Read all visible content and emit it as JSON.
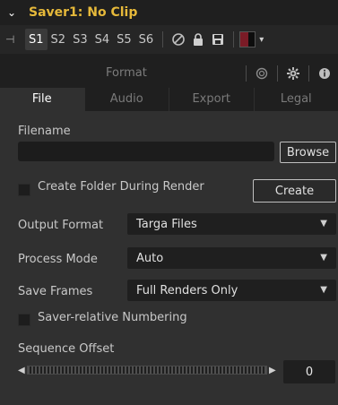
{
  "header": {
    "title": "Saver1: No Clip"
  },
  "toolbar": {
    "slots": [
      "S1",
      "S2",
      "S3",
      "S4",
      "S5",
      "S6"
    ],
    "active_slot": "S1",
    "icons": [
      "pin-icon",
      "disable-icon",
      "lock-icon",
      "save-icon",
      "color-swatch",
      "dropdown-caret"
    ]
  },
  "format_section": {
    "label": "Format"
  },
  "tabs": [
    {
      "label": "File",
      "active": true
    },
    {
      "label": "Audio",
      "active": false
    },
    {
      "label": "Export",
      "active": false
    },
    {
      "label": "Legal",
      "active": false
    }
  ],
  "file": {
    "filename_label": "Filename",
    "filename_value": "",
    "browse_label": "Browse",
    "create_folder_label": "Create Folder During Render",
    "create_button": "Create",
    "output_format_label": "Output Format",
    "output_format_value": "Targa Files",
    "process_mode_label": "Process Mode",
    "process_mode_value": "Auto",
    "save_frames_label": "Save Frames",
    "save_frames_value": "Full Renders Only",
    "saver_relative_label": "Saver-relative Numbering",
    "sequence_offset_label": "Sequence Offset",
    "sequence_offset_value": "0"
  },
  "colors": {
    "title": "#e6b93a",
    "panel_bg": "#303030",
    "field_bg": "#1f1f1f",
    "swatch_red": "#7a1b26"
  }
}
